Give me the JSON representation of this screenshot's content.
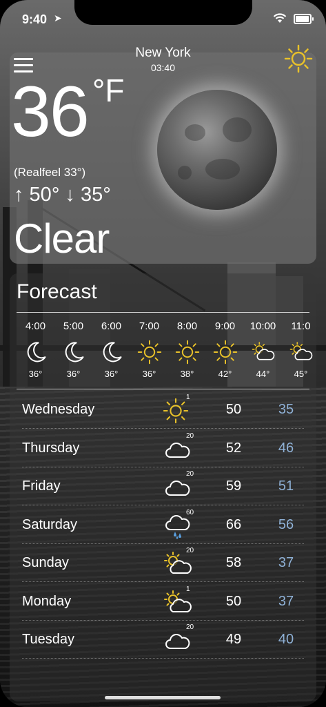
{
  "status": {
    "time": "9:40"
  },
  "header": {
    "city": "New York",
    "local_time": "03:40",
    "menu_icon": "hamburger-icon",
    "top_icon": "sun-icon"
  },
  "now": {
    "temp": "36",
    "unit": "°F",
    "realfeel": "(Realfeel 33°)",
    "hilo": "↑ 50° ↓ 35°",
    "condition": "Clear",
    "image": "moon"
  },
  "forecast": {
    "title": "Forecast",
    "hourly": [
      {
        "time": "4:00",
        "icon": "moon",
        "temp": "36°"
      },
      {
        "time": "5:00",
        "icon": "moon",
        "temp": "36°"
      },
      {
        "time": "6:00",
        "icon": "moon",
        "temp": "36°"
      },
      {
        "time": "7:00",
        "icon": "sun",
        "temp": "36°"
      },
      {
        "time": "8:00",
        "icon": "sun",
        "temp": "38°"
      },
      {
        "time": "9:00",
        "icon": "sun",
        "temp": "42°"
      },
      {
        "time": "10:00",
        "icon": "sun-cloud",
        "temp": "44°"
      },
      {
        "time": "11:0",
        "icon": "sun-cloud",
        "temp": "45°"
      }
    ],
    "daily": [
      {
        "day": "Wednesday",
        "icon": "sun",
        "prob": "1",
        "hi": "50",
        "lo": "35"
      },
      {
        "day": "Thursday",
        "icon": "cloud",
        "prob": "20",
        "hi": "52",
        "lo": "46"
      },
      {
        "day": "Friday",
        "icon": "cloud",
        "prob": "20",
        "hi": "59",
        "lo": "51"
      },
      {
        "day": "Saturday",
        "icon": "rain",
        "prob": "60",
        "hi": "66",
        "lo": "56"
      },
      {
        "day": "Sunday",
        "icon": "sun-cloud",
        "prob": "20",
        "hi": "58",
        "lo": "37"
      },
      {
        "day": "Monday",
        "icon": "sun-cloud",
        "prob": "1",
        "hi": "50",
        "lo": "37"
      },
      {
        "day": "Tuesday",
        "icon": "cloud",
        "prob": "20",
        "hi": "49",
        "lo": "40"
      }
    ]
  },
  "colors": {
    "sun": "#e8c12a",
    "low_temp": "#8fb1d6",
    "rain": "#5aa0e0"
  }
}
